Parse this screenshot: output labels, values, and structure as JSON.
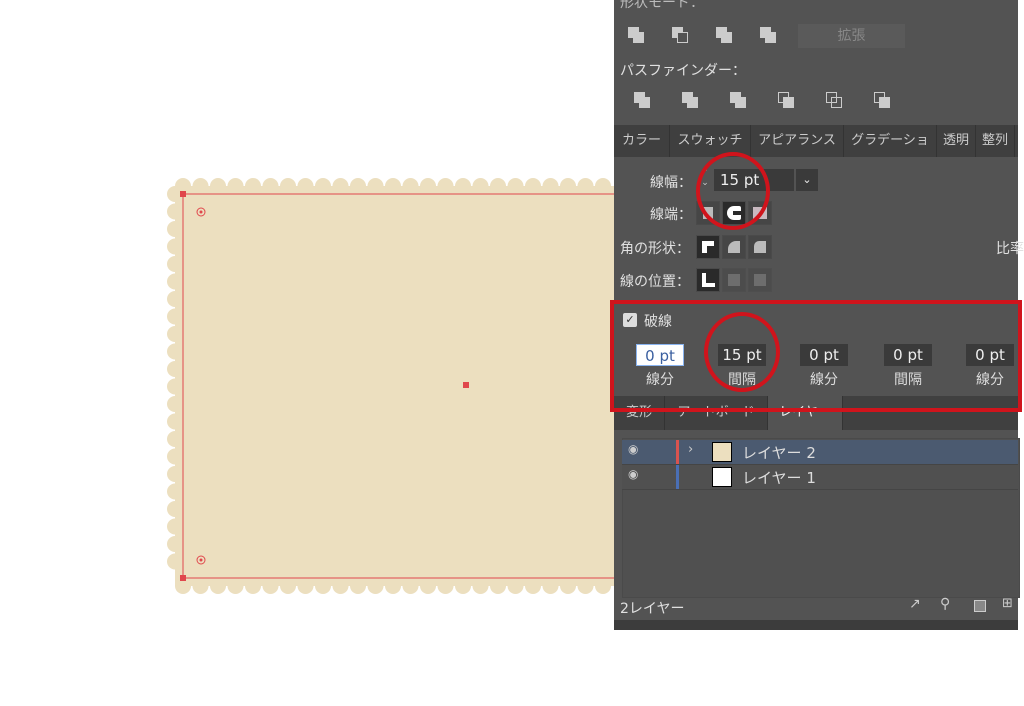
{
  "shape_modes": {
    "label": "形状モード：",
    "expand_button": "拡張"
  },
  "pathfinder": {
    "label": "パスファインダー："
  },
  "top_tabs": [
    "カラー",
    "スウォッチ",
    "アピアランス",
    "グラデーショ",
    "透明",
    "整列"
  ],
  "stroke": {
    "weight_label": "線幅：",
    "weight_value": "15 pt",
    "cap_label": "線端：",
    "corner_label": "角の形状：",
    "align_label": "線の位置：",
    "ratio_label": "比率",
    "dashed_label": "破線",
    "dashed_checked": true,
    "dash_fields": [
      {
        "value": "0 pt",
        "label": "線分"
      },
      {
        "value": "15 pt",
        "label": "間隔"
      },
      {
        "value": "0 pt",
        "label": "線分"
      },
      {
        "value": "0 pt",
        "label": "間隔"
      },
      {
        "value": "0 pt",
        "label": "線分"
      }
    ]
  },
  "bottom_tabs": [
    "変形",
    "アートボード",
    "レイヤー"
  ],
  "layers": [
    {
      "name": "レイヤー 2",
      "color": "#d9534f",
      "selected": true
    },
    {
      "name": "レイヤー 1",
      "color": "#4a6fb5",
      "selected": false
    }
  ],
  "layers_count": "2レイヤー",
  "colors": {
    "artwork_fill": "#ecdfbf",
    "selection": "#e0474c",
    "highlight": "#d0141c"
  }
}
